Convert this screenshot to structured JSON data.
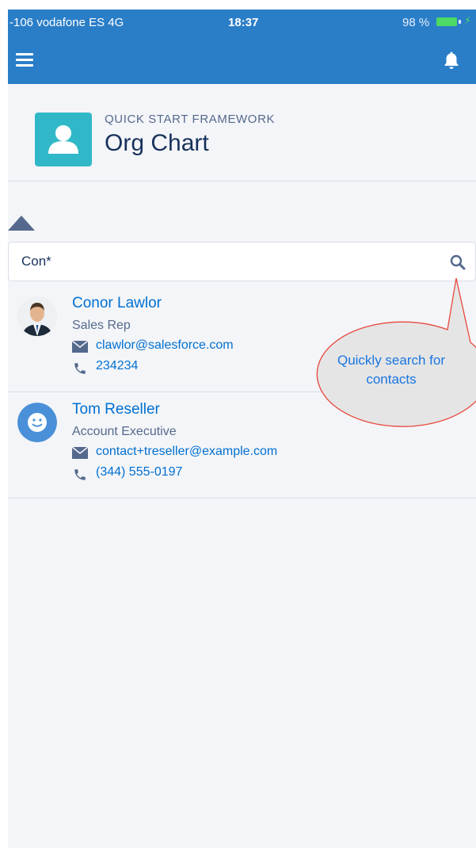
{
  "status_bar": {
    "carrier": "-106 vodafone ES  4G",
    "time": "18:37",
    "battery": "98 %"
  },
  "header": {
    "eyebrow": "QUICK START FRAMEWORK",
    "title": "Org Chart"
  },
  "search": {
    "value": "Con*",
    "placeholder": ""
  },
  "contacts": [
    {
      "name": "Conor Lawlor",
      "title": "Sales Rep",
      "email": "clawlor@salesforce.com",
      "phone": "234234"
    },
    {
      "name": "Tom Reseller",
      "title": "Account Executive",
      "email": "contact+treseller@example.com",
      "phone": "(344) 555-0197"
    }
  ],
  "callout": {
    "text": "Quickly search for contacts"
  },
  "colors": {
    "nav_bar": "#2a7ec8",
    "link": "#0070d2",
    "app_icon": "#30b8c8",
    "callout_fill": "#e5e5e5",
    "callout_border": "#e8483c"
  },
  "icons": {
    "menu": "hamburger-icon",
    "notifications": "bell-icon",
    "app": "user-icon",
    "search": "search-icon",
    "email": "envelope-icon",
    "phone": "phone-icon"
  }
}
